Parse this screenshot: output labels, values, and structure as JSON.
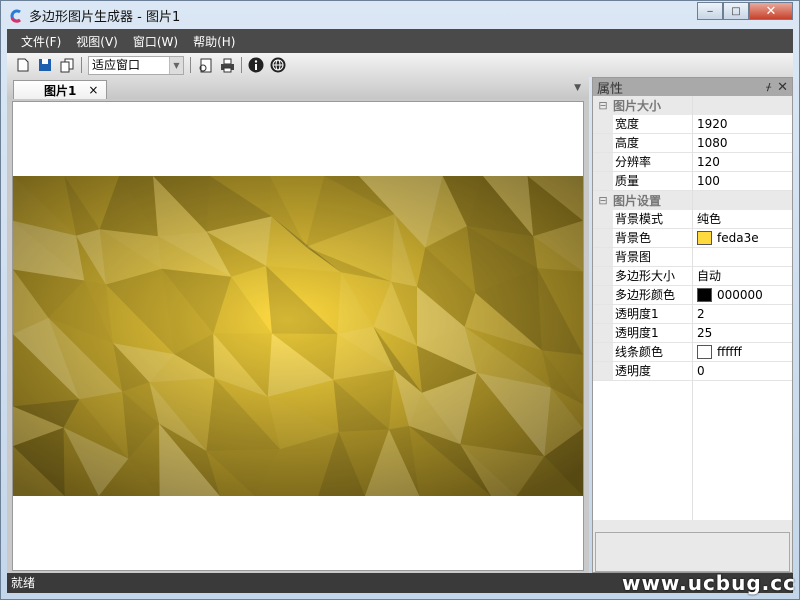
{
  "window": {
    "title": "多边形图片生成器 - 图片1",
    "minimize": "‒",
    "maximize": "□",
    "close": "✕"
  },
  "menu": [
    "文件(F)",
    "视图(V)",
    "窗口(W)",
    "帮助(H)"
  ],
  "toolbar": {
    "zoom_value": "适应窗口"
  },
  "tab": {
    "label": "图片1",
    "close": "×"
  },
  "properties": {
    "title": "属性",
    "pin": "ᚋ",
    "close": "✕",
    "categories": [
      {
        "name": "图片大小",
        "toggle": "⊟",
        "rows": [
          {
            "k": "宽度",
            "v": "1920"
          },
          {
            "k": "高度",
            "v": "1080"
          },
          {
            "k": "分辨率",
            "v": "120"
          },
          {
            "k": "质量",
            "v": "100"
          }
        ]
      },
      {
        "name": "图片设置",
        "toggle": "⊟",
        "rows": [
          {
            "k": "背景模式",
            "v": "纯色"
          },
          {
            "k": "背景色",
            "v": "feda3e",
            "color": "#feda3e"
          },
          {
            "k": "背景图",
            "v": ""
          },
          {
            "k": "多边形大小",
            "v": "自动"
          },
          {
            "k": "多边形颜色",
            "v": "000000",
            "color": "#000000"
          },
          {
            "k": "透明度1",
            "v": "2"
          },
          {
            "k": "透明度1",
            "v": "25"
          },
          {
            "k": "线条颜色",
            "v": "ffffff",
            "color": "#ffffff"
          },
          {
            "k": "透明度",
            "v": "0"
          }
        ]
      }
    ]
  },
  "status": "就绪",
  "watermark": "www.ucbug.cc",
  "colors": {
    "bg": "#feda3e"
  }
}
